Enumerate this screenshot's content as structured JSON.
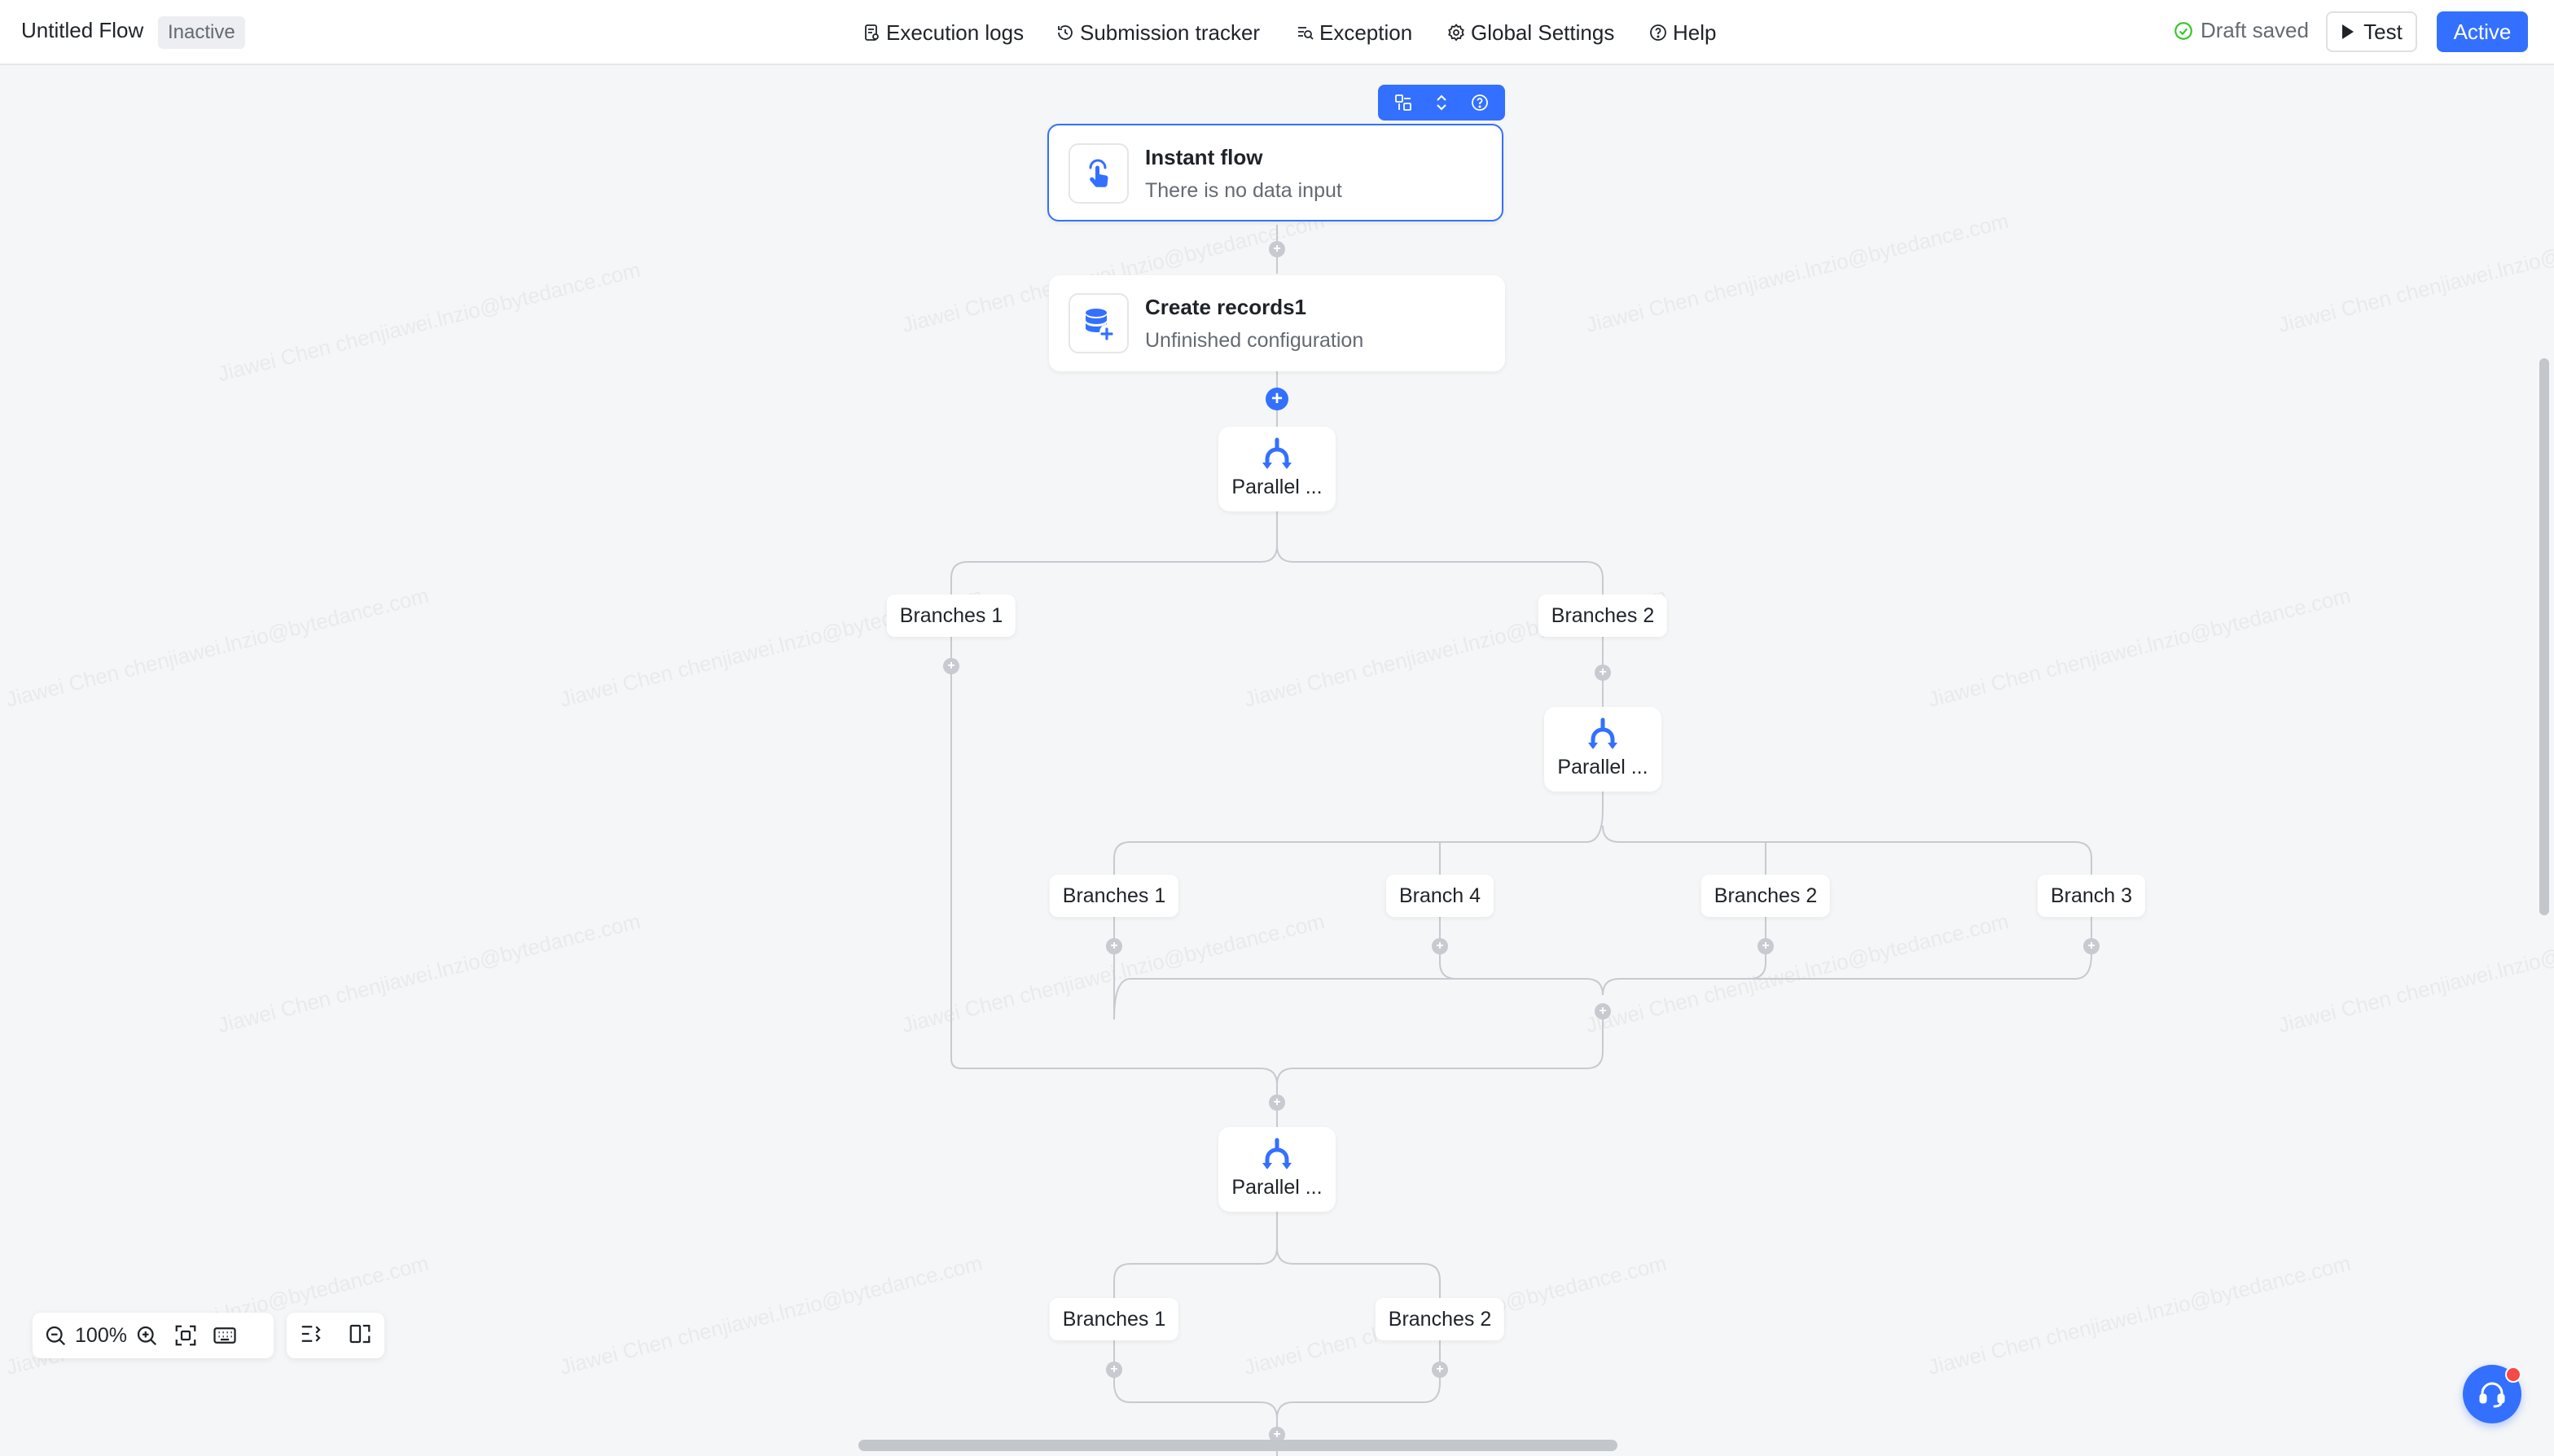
{
  "header": {
    "flow_title": "Untitled Flow",
    "status": "Inactive",
    "nav": [
      {
        "label": "Execution logs",
        "icon": "log-icon"
      },
      {
        "label": "Submission tracker",
        "icon": "history-icon"
      },
      {
        "label": "Exception",
        "icon": "exception-icon"
      },
      {
        "label": "Global Settings",
        "icon": "gear-icon"
      },
      {
        "label": "Help",
        "icon": "help-icon"
      }
    ],
    "save_status": "Draft saved",
    "test_label": "Test",
    "active_label": "Active"
  },
  "flow": {
    "trigger": {
      "title": "Instant flow",
      "subtitle": "There is no data input",
      "icon": "tap-hand-icon"
    },
    "action": {
      "title": "Create records1",
      "subtitle": "Unfinished configuration",
      "icon": "database-add-icon"
    },
    "parallel_nodes": [
      "Parallel ...",
      "Parallel ...",
      "Parallel ..."
    ],
    "branches_level1": [
      "Branches 1",
      "Branches 2"
    ],
    "branches_level2": [
      "Branches 1",
      "Branch 4",
      "Branches 2",
      "Branch 3"
    ],
    "branches_level3": [
      "Branches 1",
      "Branches 2"
    ]
  },
  "watermark": "Jiawei Chen chenjiawei.lnzio@bytedance.com",
  "zoom": {
    "level": "100%"
  },
  "colors": {
    "accent": "#3370ff",
    "success": "#34c724",
    "edge": "#c7cad0",
    "canvas": "#f5f6f7"
  }
}
